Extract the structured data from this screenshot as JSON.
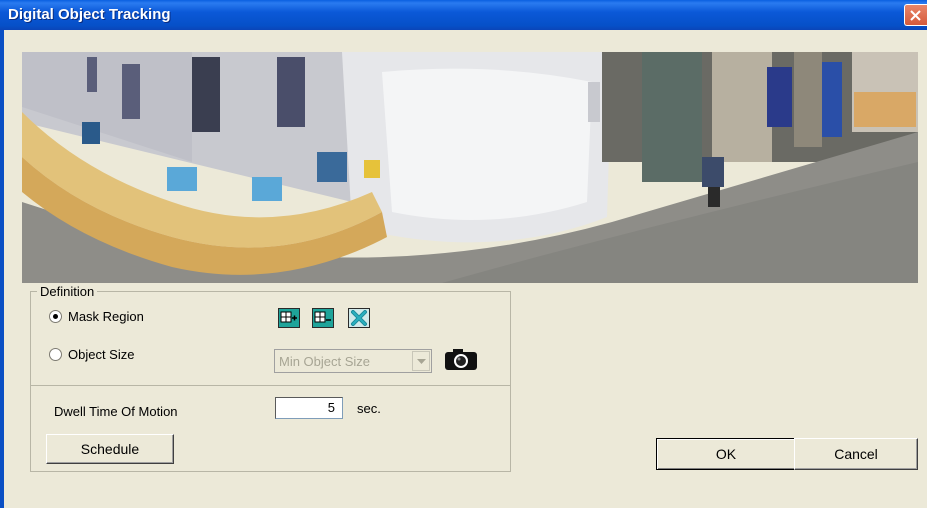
{
  "window": {
    "title": "Digital Object Tracking"
  },
  "panorama": {
    "description_icon": "panorama-camera-view"
  },
  "definition": {
    "legend": "Definition",
    "mask_region_label": "Mask Region",
    "object_size_label": "Object Size",
    "selected_mode": "Mask Region",
    "object_size_select": {
      "placeholder": "Min Object Size",
      "disabled": true
    },
    "tools": [
      {
        "icon": "add-region-icon"
      },
      {
        "icon": "remove-region-icon"
      },
      {
        "icon": "clear-region-icon"
      }
    ],
    "dwell_label": "Dwell Time Of Motion",
    "dwell_value": "5",
    "dwell_unit": "sec.",
    "schedule_label": "Schedule"
  },
  "footer": {
    "ok_label": "OK",
    "cancel_label": "Cancel"
  },
  "colors": {
    "title_bar": "#0b59d8",
    "dialog_bg": "#ece9d8",
    "tool_accent": "#1fa49a",
    "close_button": "#d65a3a"
  }
}
